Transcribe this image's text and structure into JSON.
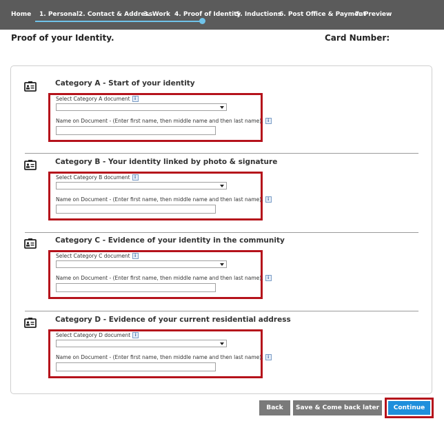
{
  "nav": {
    "items": [
      {
        "label": "Home"
      },
      {
        "label": "1. Personal"
      },
      {
        "label": "2. Contact & Address"
      },
      {
        "label": "3. Work"
      },
      {
        "label": "4. Proof of Identity"
      },
      {
        "label": "5. Inductions"
      },
      {
        "label": "6. Post Office & Payment"
      },
      {
        "label": "7. Preview"
      }
    ],
    "progress_color": "#6fc3ea"
  },
  "page": {
    "title": "Proof of your Identity.",
    "card_number_label": "Card Number:"
  },
  "categories": [
    {
      "title": "Category A - Start of your identity",
      "select_label": "Select Category A document",
      "name_label": "Name on Document - (Enter first name, then middle name and then last name).",
      "select_value": "",
      "name_value": ""
    },
    {
      "title": "Category B - Your identity linked by photo & signature",
      "select_label": "Select Category B document",
      "name_label": "Name on Document - (Enter first name, then middle name and then last name).",
      "select_value": "",
      "name_value": ""
    },
    {
      "title": "Category C - Evidence of your identity in the community",
      "select_label": "Select Category C document",
      "name_label": "Name on Document - (Enter first name, then middle name and then last name).",
      "select_value": "",
      "name_value": ""
    },
    {
      "title": "Category D - Evidence of your current residential address",
      "select_label": "Select Category D document",
      "name_label": "Name on Document - (Enter first name, then middle name and then last name).",
      "select_value": "",
      "name_value": ""
    }
  ],
  "info_icon_glyph": "i",
  "buttons": {
    "back": "Back",
    "save": "Save & Come back later",
    "continue": "Continue"
  },
  "colors": {
    "highlight_red": "#b5121b",
    "continue_blue": "#1e8fdc",
    "header_gray": "#5b5b5b"
  }
}
